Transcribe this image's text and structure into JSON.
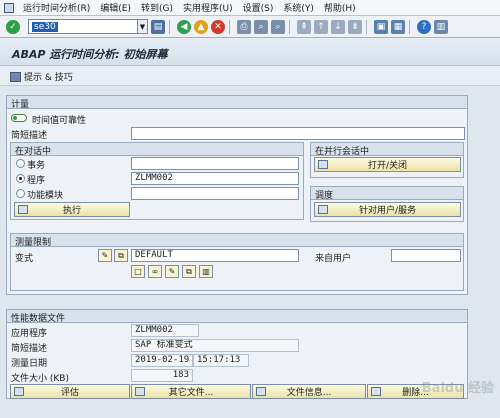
{
  "menu": {
    "items": [
      "运行时间分析(R)",
      "编辑(E)",
      "转到(G)",
      "实用程序(U)",
      "设置(S)",
      "系统(Y)",
      "帮助(H)"
    ]
  },
  "toolbar": {
    "tcode_value": "se30",
    "icons": [
      "enter-icon",
      "save-icon",
      "back-icon",
      "exit-icon",
      "cancel-icon",
      "print-icon",
      "find-icon",
      "find-next-icon",
      "first-page-icon",
      "prev-page-icon",
      "next-page-icon",
      "last-page-icon",
      "new-session-icon",
      "shortcut-icon",
      "help-icon",
      "layout-icon"
    ]
  },
  "title": "ABAP 运行时间分析: 初始屏幕",
  "app_toolbar": {
    "hint_label": "提示 & 技巧"
  },
  "measurement": {
    "header": "计量",
    "reliability_label": "时间值可靠性",
    "short_desc_label": "简短描述",
    "short_desc_value": "",
    "in_dialog": {
      "header": "在对话中",
      "transaction_label": "事务",
      "transaction_value": "",
      "program_label": "程序",
      "program_value": "ZLMM002",
      "function_module_label": "功能模块",
      "function_module_value": "",
      "execute_label": "执行"
    },
    "parallel_session": {
      "header": "在并行会话中",
      "switch_label": "打开/关闭"
    },
    "schedule": {
      "header": "调度",
      "for_user_label": "针对用户/服务"
    },
    "restrictions": {
      "header": "测量限制",
      "variant_label": "变式",
      "variant_value": "DEFAULT",
      "from_user_label": "来自用户",
      "from_user_value": ""
    }
  },
  "perf_file": {
    "header": "性能数据文件",
    "app_label": "应用程序",
    "app_value": "ZLMM002",
    "desc_label": "简短描述",
    "desc_value": "SAP 标准变式",
    "date_label": "测量日期",
    "date_value": "2019-02-19",
    "time_value": "15:17:13",
    "size_label": "文件大小 (KB)",
    "size_value": "183",
    "buttons": {
      "evaluate": "评估",
      "other_file": "其它文件...",
      "file_info": "文件信息...",
      "delete": "删除..."
    }
  },
  "watermark": "Baidu 经验"
}
